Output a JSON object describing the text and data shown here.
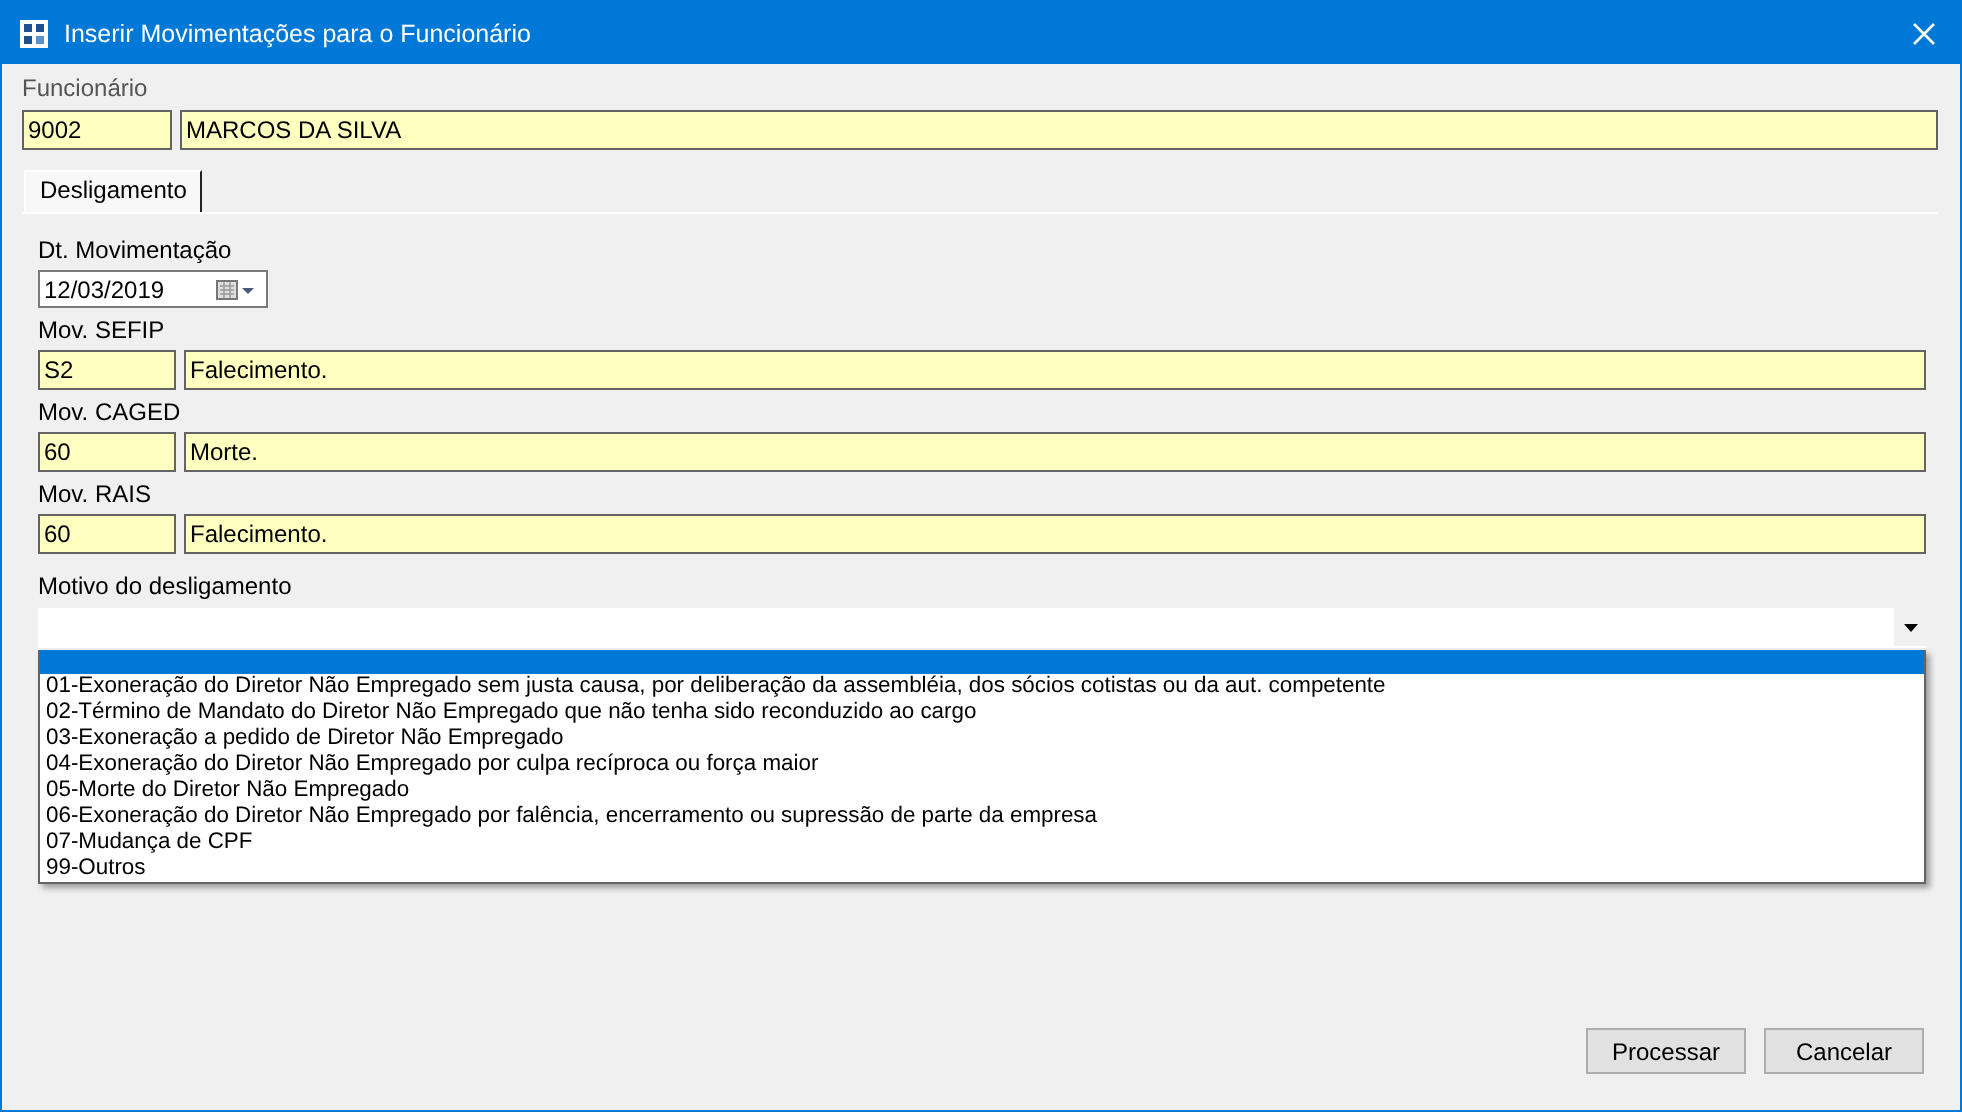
{
  "window": {
    "title": "Inserir Movimentações para o Funcionário"
  },
  "employee": {
    "label": "Funcionário",
    "code": "9002",
    "name": "MARCOS DA SILVA"
  },
  "tabs": [
    {
      "label": "Desligamento",
      "selected": true
    }
  ],
  "date_field": {
    "label": "Dt. Movimentação",
    "value": "12/03/2019"
  },
  "movements": [
    {
      "label": "Mov. SEFIP",
      "code": "S2",
      "description": "Falecimento."
    },
    {
      "label": "Mov. CAGED",
      "code": "60",
      "description": "Morte."
    },
    {
      "label": "Mov. RAIS",
      "code": "60",
      "description": "Falecimento."
    }
  ],
  "reason": {
    "label": "Motivo do desligamento",
    "open": true,
    "blank_option": {
      "selected": true
    },
    "options": [
      {
        "label": "01-Exoneração do Diretor Não Empregado sem justa causa, por deliberação da assembléia, dos sócios cotistas ou da aut. competente",
        "selected": false
      },
      {
        "label": "02-Término de Mandato do Diretor Não Empregado que não tenha sido reconduzido ao cargo",
        "selected": false
      },
      {
        "label": "03-Exoneração a pedido de Diretor Não Empregado",
        "selected": false
      },
      {
        "label": "04-Exoneração do Diretor Não Empregado por culpa recíproca ou força maior",
        "selected": false
      },
      {
        "label": "05-Morte do Diretor Não Empregado",
        "selected": false
      },
      {
        "label": "06-Exoneração do Diretor Não Empregado por falência, encerramento ou supressão de parte da empresa",
        "selected": false
      },
      {
        "label": "07-Mudança de CPF",
        "selected": false
      },
      {
        "label": "99-Outros",
        "selected": false
      }
    ]
  },
  "buttons": [
    "Processar",
    "Cancelar"
  ]
}
